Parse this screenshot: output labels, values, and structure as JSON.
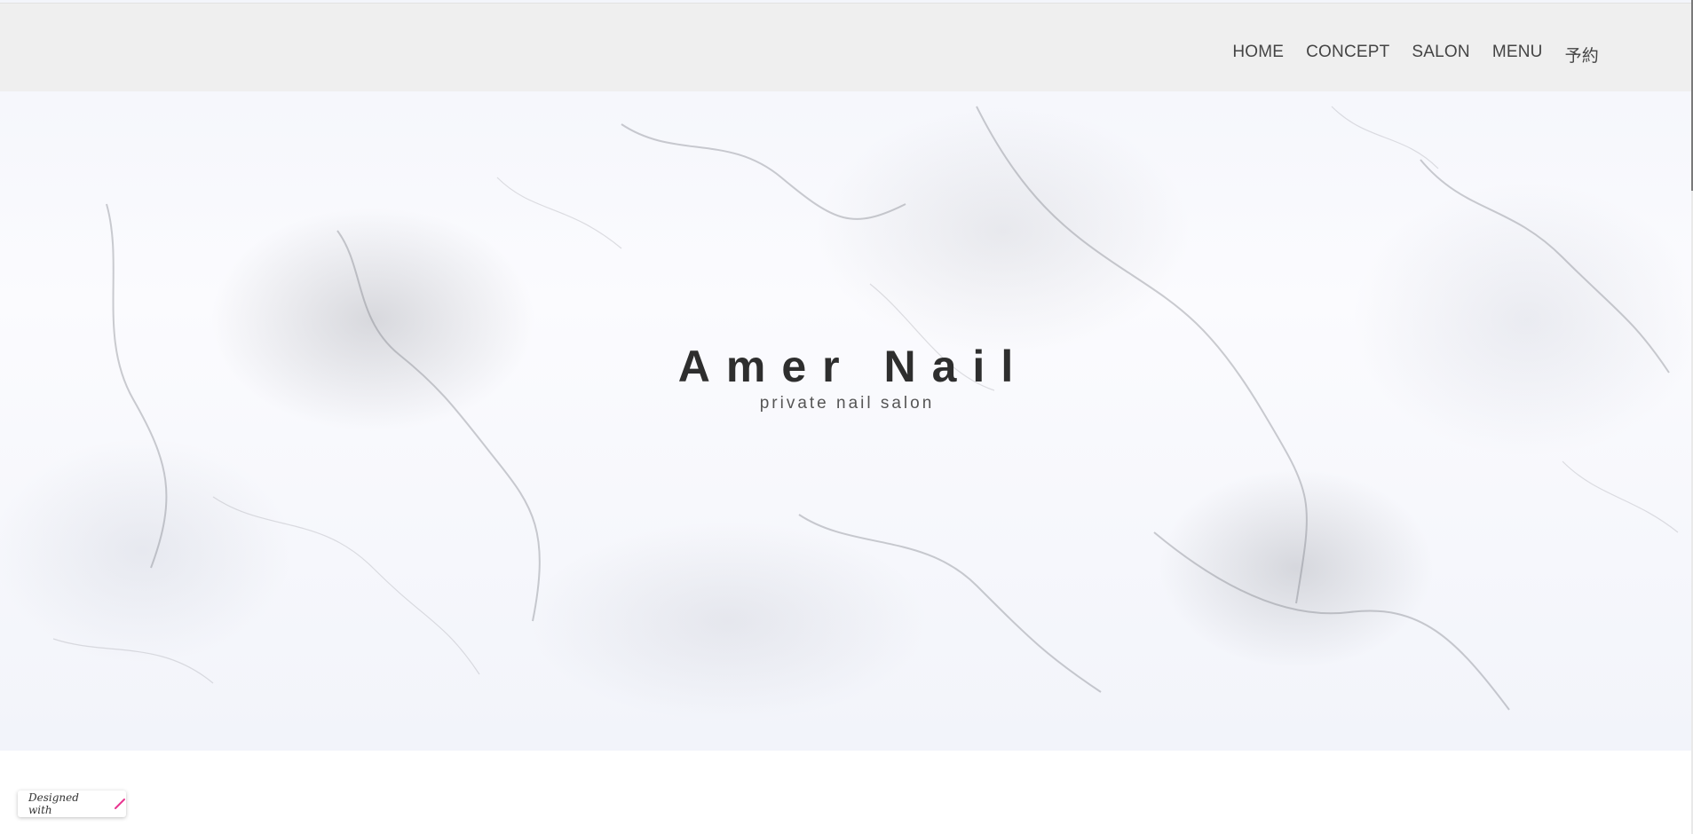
{
  "nav": {
    "items": [
      "HOME",
      "CONCEPT",
      "SALON",
      "MENU",
      "予約"
    ]
  },
  "hero": {
    "title": "Amer Nail",
    "subtitle": "private nail salon"
  },
  "badge": {
    "label": "Designed with",
    "icon": "pen-stroke-icon",
    "icon_color": "#e8348f"
  },
  "colors": {
    "header_bg": "#eeeeee",
    "text": "#333333"
  }
}
